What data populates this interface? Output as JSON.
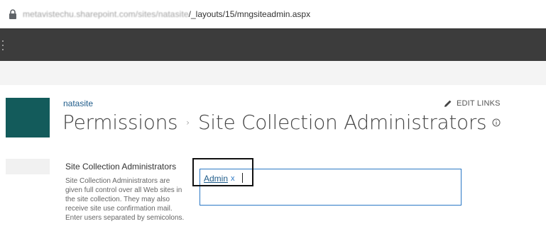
{
  "browser": {
    "url_host": "metavistechu.sharepoint.com/sites/natasite",
    "url_path": "/_layouts/15/mngsiteadmin.aspx"
  },
  "site": {
    "name": "natasite",
    "edit_links_label": "EDIT LINKS"
  },
  "page": {
    "breadcrumb_parent": "Permissions",
    "breadcrumb_separator": "›",
    "title": "Site Collection Administrators"
  },
  "section": {
    "title": "Site Collection Administrators",
    "description": "Site Collection Administrators are given full control over all Web sites in the site collection. They may also receive site use confirmation mail. Enter users separated by semicolons."
  },
  "picker": {
    "entries": [
      {
        "name": "Admin",
        "remove_label": "x"
      }
    ]
  },
  "colors": {
    "suite_bar": "#3c3c3c",
    "site_logo": "#135b5b",
    "link": "#1f5c8a",
    "picker_border": "#2b78c5"
  },
  "icons": {
    "lock": "lock-icon",
    "pencil": "pencil-icon",
    "info": "info-icon",
    "waffle": "app-launcher-icon"
  }
}
